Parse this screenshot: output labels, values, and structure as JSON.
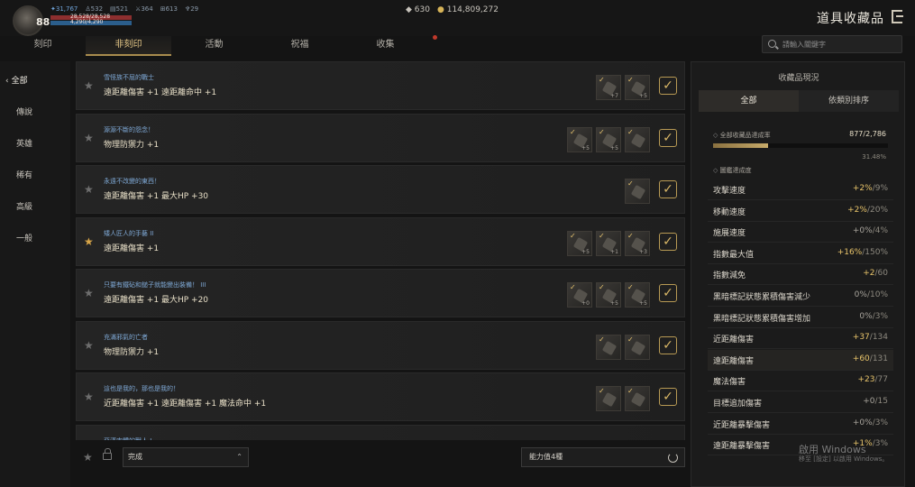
{
  "header": {
    "level": "88",
    "stats": [
      "31,767",
      "532",
      "521",
      "364",
      "613",
      "29"
    ],
    "hp": "28,528/28,528",
    "mp": "4,290/4,290",
    "currency_a": "630",
    "currency_b": "114,809,272",
    "title": "道具收藏品"
  },
  "tabs": [
    "刻印",
    "非刻印",
    "活動",
    "祝福",
    "收集"
  ],
  "search": {
    "placeholder": "請輸入關鍵字"
  },
  "sidebar": [
    "全部",
    "傳說",
    "英雄",
    "稀有",
    "高級",
    "一般"
  ],
  "rows": [
    {
      "name": "雪怪族不屈的戰士",
      "effect": "遠距離傷害 +1  遠距離命中 +1",
      "starred": false,
      "items": [
        {
          "qty": "+7"
        },
        {
          "qty": "+5"
        }
      ]
    },
    {
      "name": "源源不斷的怨念！",
      "effect": "物理防禦力 +1",
      "starred": false,
      "items": [
        {
          "qty": "+5"
        },
        {
          "qty": "+5"
        },
        {
          "qty": ""
        }
      ]
    },
    {
      "name": "永遠不改變的東西！",
      "effect": "遠距離傷害 +1  最大HP +30",
      "starred": false,
      "items": [
        {
          "qty": ""
        }
      ]
    },
    {
      "name": "矮人匠人的手藝 II",
      "effect": "遠距離傷害 +1",
      "starred": true,
      "items": [
        {
          "qty": "+5"
        },
        {
          "qty": "+1"
        },
        {
          "qty": "+3"
        }
      ]
    },
    {
      "name": "只要有鐵砧和鎚子就能變出裝備！ III",
      "effect": "遠距離傷害 +1  最大HP +20",
      "starred": false,
      "items": [
        {
          "qty": "+0"
        },
        {
          "qty": "+5"
        },
        {
          "qty": "+5"
        }
      ]
    },
    {
      "name": "充滿邪氣的亡者",
      "effect": "物理防禦力 +1",
      "starred": false,
      "items": [
        {
          "qty": ""
        },
        {
          "qty": ""
        }
      ]
    },
    {
      "name": "這也是我的，那也是我的！",
      "effect": "近距離傷害 +1  遠距離傷害 +1  魔法命中 +1",
      "starred": false,
      "items": [
        {
          "qty": ""
        },
        {
          "qty": ""
        }
      ]
    },
    {
      "name": "亞漢肉體的獸人 I",
      "effect": "",
      "starred": false,
      "items": []
    }
  ],
  "bottom": {
    "filter": "完成",
    "power": "能力值4種"
  },
  "panel": {
    "title": "收藏品現況",
    "tabs": [
      "全部",
      "依類別排序"
    ],
    "total_label": "全部收藏品達成率",
    "total_value": "877/2,786",
    "total_percent": "31.48%",
    "total_fraction": 0.3148,
    "section_label": "圖鑑達成度",
    "stats": [
      {
        "label": "攻擊速度",
        "cur": "+2%",
        "max": "/9%"
      },
      {
        "label": "移動速度",
        "cur": "+2%",
        "max": "/20%"
      },
      {
        "label": "施展速度",
        "cur": "+0%",
        "max": "/4%"
      },
      {
        "label": "指數最大值",
        "cur": "+16%",
        "max": "/150%"
      },
      {
        "label": "指數減免",
        "cur": "+2",
        "max": "/60"
      },
      {
        "label": "黑暗標記狀態累積傷害減少",
        "cur": "0%",
        "max": "/10%"
      },
      {
        "label": "黑暗標記狀態累積傷害增加",
        "cur": "0%",
        "max": "/3%"
      },
      {
        "label": "近距離傷害",
        "cur": "+37",
        "max": "/134"
      },
      {
        "label": "遠距離傷害",
        "cur": "+60",
        "max": "/131"
      },
      {
        "label": "魔法傷害",
        "cur": "+23",
        "max": "/77"
      },
      {
        "label": "目標追加傷害",
        "cur": "+0",
        "max": "/15"
      },
      {
        "label": "近距離暴擊傷害",
        "cur": "+0%",
        "max": "/3%"
      },
      {
        "label": "遠距離暴擊傷害",
        "cur": "+1%",
        "max": "/3%"
      }
    ]
  },
  "watermark": {
    "line1": "啟用 Windows",
    "line2": "移至 [設定] 以啟用 Windows。"
  }
}
